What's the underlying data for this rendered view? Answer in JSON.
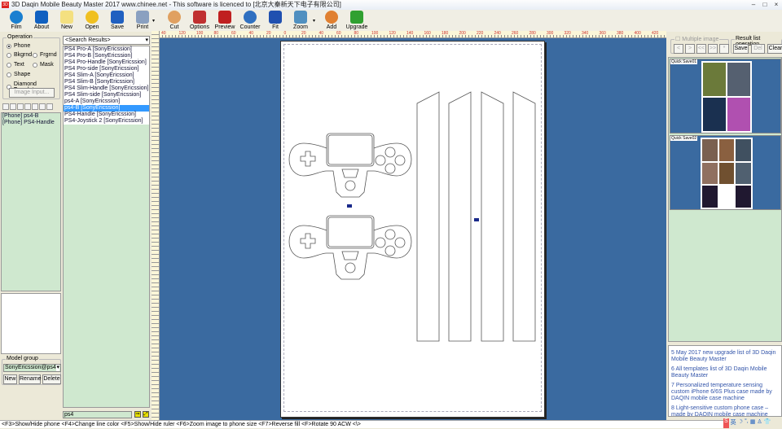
{
  "window": {
    "title": "3D Daqin Mobile Beauty Master 2017 www.chinee.net - This software is licenced to [北京大秦新天下电子有限公司]",
    "logo": "3D"
  },
  "toolbar": [
    {
      "label": "Film",
      "color": "#1a7fd0"
    },
    {
      "label": "About",
      "color": "#1060c0"
    },
    {
      "label": "New",
      "color": "#f4e080"
    },
    {
      "label": "Open",
      "color": "#f0c020"
    },
    {
      "label": "Save",
      "color": "#2060c0"
    },
    {
      "label": "Print",
      "color": "#8aa0c0"
    },
    {
      "label": "Cut",
      "color": "#e0a060"
    },
    {
      "label": "Options",
      "color": "#c03030"
    },
    {
      "label": "Preview",
      "color": "#c02020"
    },
    {
      "label": "Counter",
      "color": "#3070c0"
    },
    {
      "label": "Fit",
      "color": "#2050b0"
    },
    {
      "label": "Zoom",
      "color": "#5090c0"
    },
    {
      "label": "Add",
      "color": "#e08030"
    },
    {
      "label": "Upgrade",
      "color": "#30a030"
    }
  ],
  "operation": {
    "title": "Operation",
    "radios": [
      {
        "label": "Phone",
        "checked": true
      },
      {
        "label": "Bkgrnd"
      },
      {
        "label": "Frgrnd"
      },
      {
        "label": "Text"
      },
      {
        "label": "Mask"
      },
      {
        "label": "Shape"
      },
      {
        "label": "Diamond Template"
      }
    ],
    "image_input": "Image Input..."
  },
  "layers": [
    "[Phone] ps4-B",
    "[Phone] PS4-Handle"
  ],
  "model_group": {
    "title": "Model group",
    "value": "SonyEricssion@ps4",
    "new": "New",
    "rename": "Rename",
    "delete": "Delete"
  },
  "search": {
    "select": "<Search Results>",
    "items": [
      "PS4 Pro-A  [SonyEricssion]",
      "PS4 Pro-B  [SonyEricssion]",
      "PS4 Pro-Handle  [SonyEricssion]",
      "PS4 Pro-side  [SonyEricssion]",
      "PS4 Slim-A  [SonyEricssion]",
      "PS4 Slim-B  [SonyEricssion]",
      "PS4 Slim-Handle  [SonyEricssion]",
      "PS4 Slim-side  [SonyEricssion]",
      "ps4-A  [SonyEricssion]",
      "ps4-B  [SonyEricssion]",
      "PS4-Handle  [SonyEricssion]",
      "PS4-Joystick 2  [SonyEricssion]"
    ],
    "selected_index": 9,
    "query": "ps4"
  },
  "ruler_labels": [
    "40",
    "120",
    "100",
    "80",
    "60",
    "40",
    "20",
    "0",
    "20",
    "40",
    "60",
    "80",
    "100",
    "120",
    "140",
    "160",
    "180",
    "200",
    "220",
    "240",
    "260",
    "280",
    "300",
    "320",
    "340",
    "360",
    "380",
    "400",
    "420"
  ],
  "right": {
    "multiple_image": "Multiple image",
    "nav": [
      "<",
      ">",
      "<<",
      ">>",
      "*"
    ],
    "result_title": "Result list operation",
    "save": "Save",
    "del": "Del",
    "clear": "Clear",
    "saves": [
      "Quick Save01",
      "Quick Save02"
    ],
    "news": [
      "5 May 2017 new upgrade list of 3D Daqin Mobile Beauty Master",
      "6 All templates list of 3D Daqin Mobile Beauty Master",
      "7 Personalized temperature sensing custom iPhone 6/6S Plus case made by DAQIN mobile case machine",
      "8 Light-sensitive custom phone case – made by DAQIN mobile case machine"
    ]
  },
  "status": "<F3>Show/Hide phone  <F4>Change line color  <F5>Show/Hide ruler  <F6>Zoom image to phone size  <F7>Reverse fill  <F>Rotate 90 ACW  <\\>",
  "tray": [
    "S",
    "英",
    "☽",
    "°,",
    "▦",
    "♙",
    "👕"
  ]
}
